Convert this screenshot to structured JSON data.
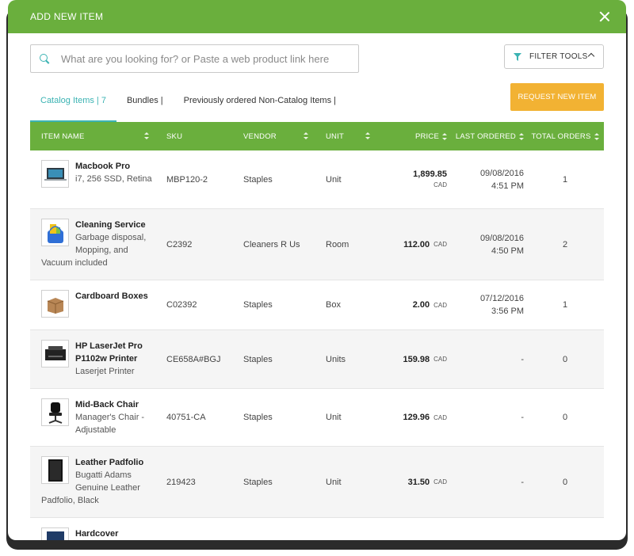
{
  "modal": {
    "title": "ADD NEW ITEM"
  },
  "search": {
    "placeholder": "What are you looking for? or Paste a web product link here"
  },
  "filter": {
    "label": "FILTER TOOLS"
  },
  "tabs": [
    {
      "label": "Catalog Items | 7"
    },
    {
      "label": "Bundles |"
    },
    {
      "label": "Previously ordered Non-Catalog Items |"
    }
  ],
  "request_button": {
    "label": "REQUEST NEW ITEM"
  },
  "table": {
    "headers": {
      "name": "ITEM NAME",
      "sku": "SKU",
      "vendor": "VENDOR",
      "unit": "UNIT",
      "price": "PRICE",
      "last_ordered": "LAST ORDERED",
      "total_orders": "TOTAL ORDERS"
    },
    "rows": [
      {
        "title": "Macbook Pro",
        "desc": "i7, 256 SSD, Retina",
        "sku": "MBP120-2",
        "vendor": "Staples",
        "unit": "Unit",
        "price": "1,899.85",
        "currency": "CAD",
        "date": "09/08/2016",
        "time": "4:51 PM",
        "total": "1"
      },
      {
        "title": "Cleaning Service",
        "desc": "Garbage disposal, Mopping, and Vacuum included",
        "sku": "C2392",
        "vendor": "Cleaners R Us",
        "unit": "Room",
        "price": "112.00",
        "currency": "CAD",
        "date": "09/08/2016",
        "time": "4:50 PM",
        "total": "2"
      },
      {
        "title": "Cardboard Boxes",
        "desc": "",
        "sku": "C02392",
        "vendor": "Staples",
        "unit": "Box",
        "price": "2.00",
        "currency": "CAD",
        "date": "07/12/2016",
        "time": "3:56 PM",
        "total": "1"
      },
      {
        "title": "HP LaserJet Pro P1102w Printer",
        "desc": "Laserjet Printer",
        "sku": "CE658A#BGJ",
        "vendor": "Staples",
        "unit": "Units",
        "price": "159.98",
        "currency": "CAD",
        "date": "-",
        "time": "",
        "total": "0"
      },
      {
        "title": "Mid-Back Chair",
        "desc": "Manager's Chair - Adjustable",
        "sku": "40751-CA",
        "vendor": "Staples",
        "unit": "Unit",
        "price": "129.96",
        "currency": "CAD",
        "date": "-",
        "time": "",
        "total": "0"
      },
      {
        "title": "Leather Padfolio",
        "desc": "Bugatti Adams Genuine Leather Padfolio, Black",
        "sku": "219423",
        "vendor": "Staples",
        "unit": "Unit",
        "price": "31.50",
        "currency": "CAD",
        "date": "-",
        "time": "",
        "total": "0"
      },
      {
        "title": "Hardcover",
        "desc": "",
        "sku": "",
        "vendor": "",
        "unit": "",
        "price": "",
        "currency": "",
        "date": "",
        "time": "",
        "total": ""
      }
    ]
  }
}
